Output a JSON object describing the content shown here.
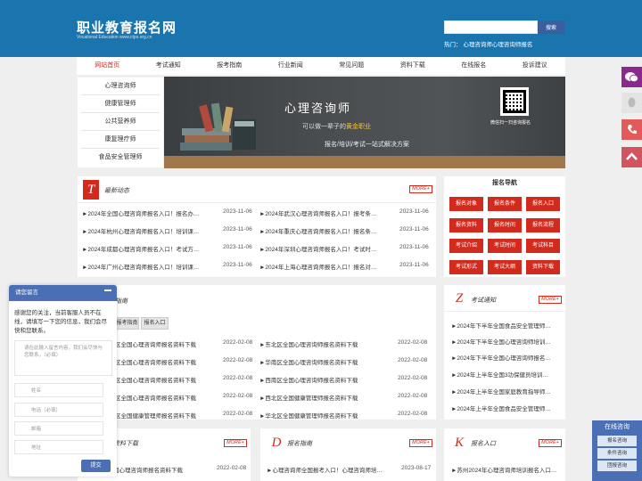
{
  "header": {
    "title": "职业教育报名网",
    "subtitle": "Vocational Education www.ctps.org.cn",
    "search_button": "搜索",
    "hot_label": "热门：",
    "hot_links": "心理咨询师心理咨询师报名"
  },
  "nav": [
    "网站首页",
    "考试通知",
    "报考指南",
    "行业新闻",
    "常见问题",
    "资料下载",
    "在线报名",
    "投诉建议"
  ],
  "left_menu": [
    "心理咨询师",
    "健康管理师",
    "公共营养师",
    "康复理疗师",
    "食品安全管理师"
  ],
  "banner": {
    "title": "心理咨询师",
    "slogan_prefix": "可以做一辈子的",
    "slogan_highlight": "黄金职业",
    "subtitle": "报名/培训/考试一站式解决方案",
    "qr_caption": "微信扫一扫咨询报名"
  },
  "news": {
    "letter": "T",
    "title": "最新动态",
    "more": "MORE+",
    "left_items": [
      {
        "text": "►2024年全国心理咨询师报名入口！报名办…",
        "date": "2023-11-06"
      },
      {
        "text": "►2024年杭州心理咨询师报名入口！培训课…",
        "date": "2023-11-06"
      },
      {
        "text": "►2024年成都心理咨询师报名入口！考试方…",
        "date": "2023-11-06"
      },
      {
        "text": "►2024年广州心理咨询师报名入口！培训课…",
        "date": "2023-11-06"
      }
    ],
    "right_items": [
      {
        "text": "►2024年武汉心理咨询师报名入口！报考条…",
        "date": "2023-11-06"
      },
      {
        "text": "►2024年重庆心理咨询师报名入口！报名条…",
        "date": "2023-11-06"
      },
      {
        "text": "►2024年深圳心理咨询师报名入口！考试时…",
        "date": "2023-11-06"
      },
      {
        "text": "►2024年上海心理咨询师报名入口！报名对…",
        "date": "2023-11-06"
      }
    ]
  },
  "reg_nav": {
    "title": "报名导航",
    "buttons": [
      "报名对象",
      "报名条件",
      "报名入口",
      "报名资料",
      "报名时间",
      "报名流程",
      "考试介绍",
      "考试时间",
      "考试科目",
      "考试形式",
      "考试大纲",
      "资料下载"
    ]
  },
  "guide": {
    "title_fragment": "指南",
    "tabs": [
      "报考指南",
      "报名入口"
    ],
    "left_items": [
      {
        "text": "区全国心理咨询师报名资料下载",
        "date": "2022-02-08"
      },
      {
        "text": "区全国心理咨询师报名资料下载",
        "date": "2022-02-08"
      },
      {
        "text": "区全国心理咨询师报名资料下载",
        "date": "2022-02-08"
      },
      {
        "text": "区全国心理咨询师报名资料下载",
        "date": "2022-02-08"
      },
      {
        "text": "区全国健康管理师报名资料下载",
        "date": "2022-02-08"
      }
    ],
    "right_items": [
      {
        "text": "►东北区全国心理咨询师报名资料下载",
        "date": "2022-02-08"
      },
      {
        "text": "►华南区全国心理咨询师报名资料下载",
        "date": "2022-02-08"
      },
      {
        "text": "►西南区全国心理咨询师报名资料下载",
        "date": "2022-02-08"
      },
      {
        "text": "►西北区全国健康管理师报名资料下载",
        "date": "2022-02-08"
      },
      {
        "text": "►华北区全国健康管理师报名资料下载",
        "date": "2022-02-08"
      }
    ]
  },
  "exam_notice": {
    "letter": "Z",
    "title": "考试通知",
    "more": "MORE+",
    "items": [
      "►2024年下半年全国食品安全管理师…",
      "►2024年下半年全国心理咨询师培训…",
      "►2024年下半年全国心理咨询师报名…",
      "►2024年上半年全国3功保健员培训…",
      "►2024年上半年全国家庭教育指导师…",
      "►2024年上半年全国食品安全管理师…"
    ]
  },
  "download": {
    "title_fragment": "资料下载",
    "more": "MORE+",
    "item": {
      "text": "国心理咨询师报名资料下载",
      "date": "2022-02-08"
    }
  },
  "guide2": {
    "letter": "D",
    "title": "报名指南",
    "more": "MORE+",
    "item": {
      "text": "►心理咨询师全国报考入口！心理咨询师培…",
      "date": "2023-08-17"
    }
  },
  "entrance": {
    "letter": "K",
    "title": "报名入口",
    "more": "MORE+",
    "item": "►苏州2024年心理咨询师培训报名入口…"
  },
  "chat": {
    "header": "请您留言",
    "message": "感谢您的关注，当前客服人员不在线，请填写一下您的信息，我们会尽快和您联系。",
    "textarea_placeholder": "请在此输入留言内容，我们会尽快与您联系。（必填）",
    "fields": [
      "姓名",
      "电话（必填）",
      "邮箱",
      "地址"
    ],
    "submit": "提交"
  },
  "online": {
    "title": "在线咨询",
    "items": [
      "报名咨询",
      "条件咨询",
      "团报咨询"
    ]
  },
  "colors": {
    "header": "#1a74ae",
    "accent": "#d22b1e",
    "chat": "#4a6fb5"
  }
}
